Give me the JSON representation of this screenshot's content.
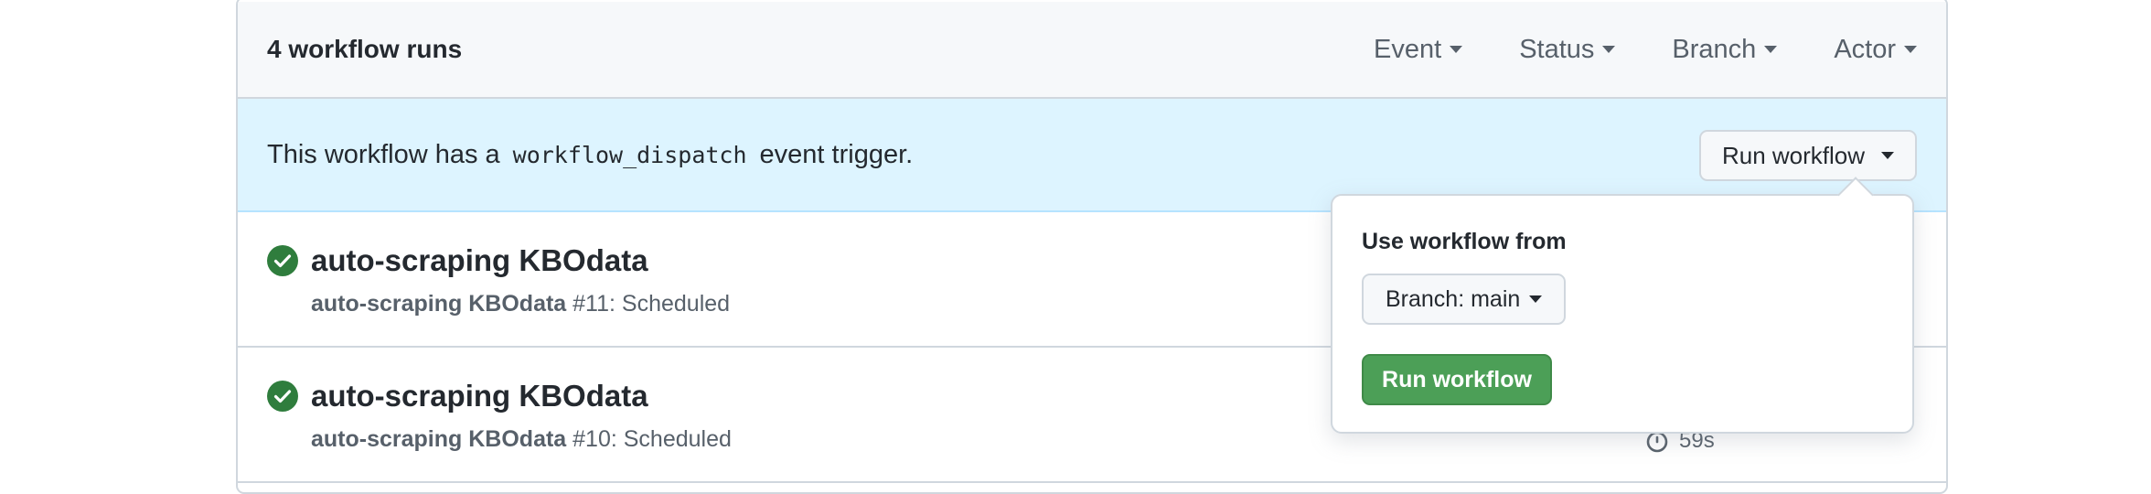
{
  "header": {
    "runs_count": "4 workflow runs",
    "filters": [
      "Event",
      "Status",
      "Branch",
      "Actor"
    ]
  },
  "banner": {
    "text_before": "This workflow has a",
    "code": "workflow_dispatch",
    "text_after": "event trigger.",
    "run_button_label": "Run workflow"
  },
  "runs": [
    {
      "title": "auto-scraping KBOdata",
      "workflow": "auto-scraping KBOdata",
      "number_and_trigger": "#11: Scheduled",
      "status": "success",
      "status_color": "#2da44e"
    },
    {
      "title": "auto-scraping KBOdata",
      "workflow": "auto-scraping KBOdata",
      "number_and_trigger": "#10: Scheduled",
      "status": "success",
      "status_color": "#2da44e",
      "duration": "59s"
    }
  ],
  "popover": {
    "label": "Use workflow from",
    "branch_button": "Branch: main",
    "run_button": "Run workflow",
    "run_button_color": "#4c9f57"
  }
}
